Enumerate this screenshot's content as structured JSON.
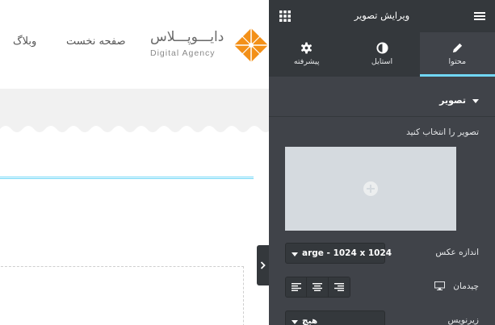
{
  "site": {
    "nav": {
      "blog": "وبلاگ",
      "home": "صفحه نخست"
    },
    "logo": {
      "name": "دایـــوپـــلاس",
      "tagline": "Digital Agency"
    },
    "colors": {
      "logo_orange": "#f39018",
      "accent": "#71d7f7"
    }
  },
  "panel": {
    "title": "ویرایش تصویر",
    "header_icons": [
      "menu-icon",
      "apps-grid-icon"
    ],
    "tabs": [
      {
        "label": "محتوا",
        "icon": "pencil-icon",
        "active": true
      },
      {
        "label": "استایل",
        "icon": "half-circle-icon",
        "active": false
      },
      {
        "label": "پیشرفته",
        "icon": "gear-icon",
        "active": false
      }
    ],
    "section": {
      "title": "تصویر",
      "icon": "caret-down-icon"
    },
    "controls": {
      "choose_image_label": "تصویر را انتخاب کنید",
      "image_size_label": "اندازه عکس",
      "image_size_value": "arge - 1024 x 1024",
      "alignment_label": "چیدمان",
      "alignment_options": [
        "align-left-icon",
        "align-center-icon",
        "align-right-icon"
      ],
      "caption_label": "زیرنویس",
      "caption_value": "هیچ"
    },
    "colors": {
      "panel_bg": "#404349",
      "header_bg": "#34383c",
      "picker_bg": "#d5dadf"
    }
  }
}
